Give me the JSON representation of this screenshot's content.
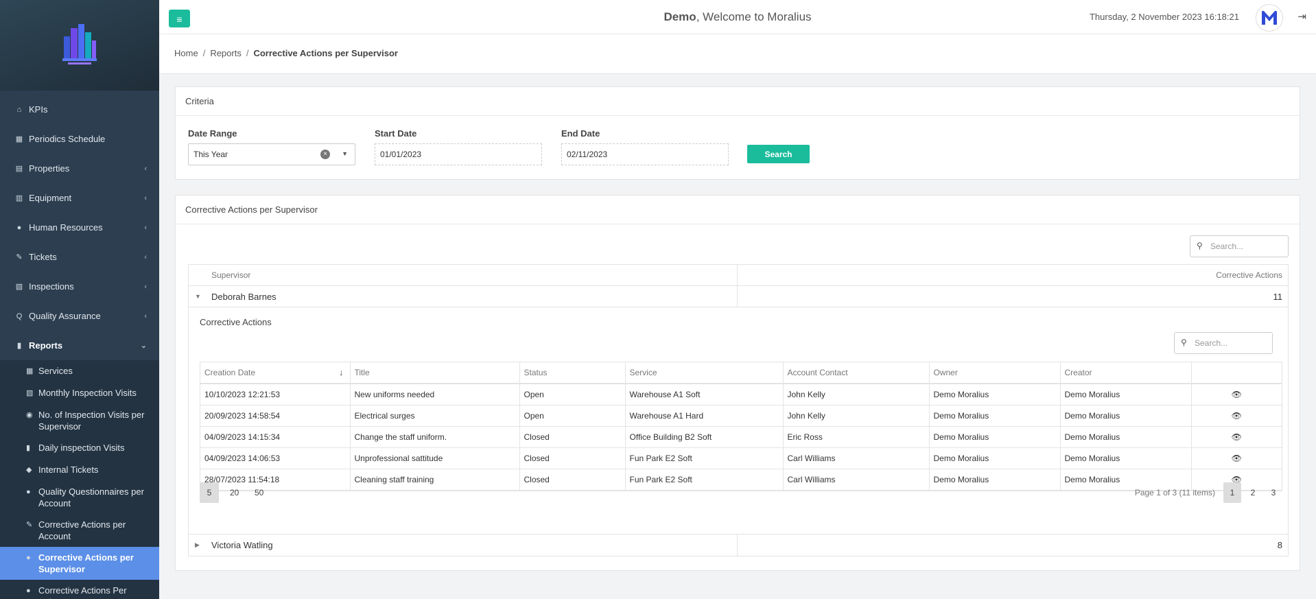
{
  "header": {
    "user": "Demo",
    "welcome": ", Welcome to Moralius",
    "datetime": "Thursday, 2 November 2023 16:18:21"
  },
  "sidebar": {
    "items": [
      {
        "label": "KPIs",
        "icon": "home-icon"
      },
      {
        "label": "Periodics Schedule",
        "icon": "calendar-icon"
      },
      {
        "label": "Properties",
        "icon": "building-icon"
      },
      {
        "label": "Equipment",
        "icon": "equipment-icon"
      },
      {
        "label": "Human Resources",
        "icon": "users-icon"
      },
      {
        "label": "Tickets",
        "icon": "ticket-icon"
      },
      {
        "label": "Inspections",
        "icon": "map-icon"
      },
      {
        "label": "Quality Assurance",
        "icon": "quality-icon"
      },
      {
        "label": "Reports",
        "icon": "book-icon"
      }
    ],
    "sub_items": [
      {
        "label": "Services",
        "icon": "calendar-check-icon"
      },
      {
        "label": "Monthly Inspection Visits",
        "icon": "map-icon"
      },
      {
        "label": "No. of Inspection Visits per Supervisor",
        "icon": "user-circle-icon"
      },
      {
        "label": "Daily inspection Visits",
        "icon": "book-icon"
      },
      {
        "label": "Internal Tickets",
        "icon": "tag-icon"
      },
      {
        "label": "Quality Questionnaires per Account",
        "icon": "check-circle-icon"
      },
      {
        "label": "Corrective Actions per Account",
        "icon": "tool-icon"
      },
      {
        "label": "Corrective Actions per Supervisor",
        "icon": "users-icon"
      },
      {
        "label": "Corrective Actions Per Subcontractor",
        "icon": "users-icon"
      }
    ]
  },
  "breadcrumb": {
    "home": "Home",
    "reports": "Reports",
    "current": "Corrective Actions per Supervisor"
  },
  "criteria": {
    "title": "Criteria",
    "date_range_label": "Date Range",
    "date_range_value": "This Year",
    "start_label": "Start Date",
    "start_value": "01/01/2023",
    "end_label": "End Date",
    "end_value": "02/11/2023",
    "search_button": "Search"
  },
  "results": {
    "title": "Corrective Actions per Supervisor",
    "search_placeholder": "Search...",
    "col_supervisor": "Supervisor",
    "col_actions": "Corrective Actions",
    "groups": [
      {
        "name": "Deborah Barnes",
        "count": "11"
      },
      {
        "name": "Victoria Watling",
        "count": "8"
      }
    ],
    "detail": {
      "title": "Corrective Actions",
      "search_placeholder": "Search...",
      "columns": [
        "Creation Date",
        "Title",
        "Status",
        "Service",
        "Account Contact",
        "Owner",
        "Creator",
        ""
      ],
      "rows": [
        [
          "10/10/2023 12:21:53",
          "New uniforms needed",
          "Open",
          "Warehouse A1 Soft",
          "John Kelly",
          "Demo Moralius",
          "Demo Moralius"
        ],
        [
          "20/09/2023 14:58:54",
          "Electrical surges",
          "Open",
          "Warehouse A1 Hard",
          "John Kelly",
          "Demo Moralius",
          "Demo Moralius"
        ],
        [
          "04/09/2023 14:15:34",
          "Change the staff uniform.",
          "Closed",
          "Office Building B2 Soft",
          "Eric Ross",
          "Demo Moralius",
          "Demo Moralius"
        ],
        [
          "04/09/2023 14:06:53",
          "Unprofessional sattitude",
          "Closed",
          "Fun Park E2 Soft",
          "Carl Williams",
          "Demo Moralius",
          "Demo Moralius"
        ],
        [
          "28/07/2023 11:54:18",
          "Cleaning staff training",
          "Closed",
          "Fun Park E2 Soft",
          "Carl Williams",
          "Demo Moralius",
          "Demo Moralius"
        ]
      ],
      "page_sizes": [
        "5",
        "20",
        "50"
      ],
      "page_info": "Page 1 of 3 (11 items)",
      "pages": [
        "1",
        "2",
        "3"
      ]
    }
  },
  "colors": {
    "accent": "#1abc9c",
    "sidebar": "#2c3e50",
    "active": "#5b8fe8"
  }
}
